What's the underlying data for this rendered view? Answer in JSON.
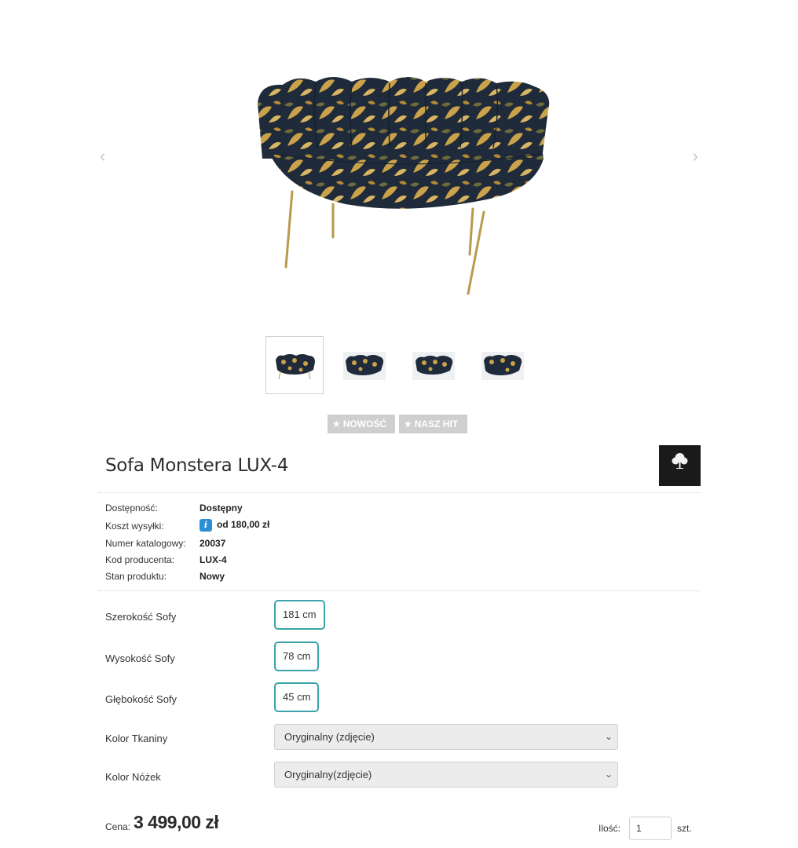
{
  "gallery": {
    "prev_icon": "chevron-left",
    "next_icon": "chevron-right",
    "prev_glyph": "‹",
    "next_glyph": "›",
    "thumbnail_count": 4,
    "active_thumbnail": 1
  },
  "badges": [
    {
      "icon": "star",
      "label": "NOWOŚĆ"
    },
    {
      "icon": "star",
      "label": "NASZ HIT"
    }
  ],
  "product": {
    "title": "Sofa Monstera LUX-4",
    "brand_logo_text": "SOFA WOOD DESIGN"
  },
  "info": {
    "availability_label": "Dostępność:",
    "availability_value": "Dostępny",
    "shipping_label": "Koszt wysyłki:",
    "shipping_value": "od 180,00 zł",
    "catalog_label": "Numer katalogowy:",
    "catalog_value": "20037",
    "producer_code_label": "Kod producenta:",
    "producer_code_value": "LUX-4",
    "condition_label": "Stan produktu:",
    "condition_value": "Nowy"
  },
  "options": {
    "width_label": "Szerokość Sofy",
    "width_value": "181 cm",
    "height_label": "Wysokość Sofy",
    "height_value": "78 cm",
    "depth_label": "Głębokość Sofy",
    "depth_value": "45 cm",
    "fabric_label": "Kolor Tkaniny",
    "fabric_value": "Oryginalny (zdjęcie)",
    "legs_label": "Kolor Nóżek",
    "legs_value": "Oryginalny(zdjęcie)"
  },
  "purchase": {
    "price_label": "Cena:",
    "price_value": "3 499,00 zł",
    "qty_label": "Ilość:",
    "qty_value": "1",
    "qty_unit": "szt."
  },
  "colors": {
    "accent": "#3ba4a8",
    "badge": "#cfcfcf",
    "info_icon": "#2a8fd4"
  }
}
